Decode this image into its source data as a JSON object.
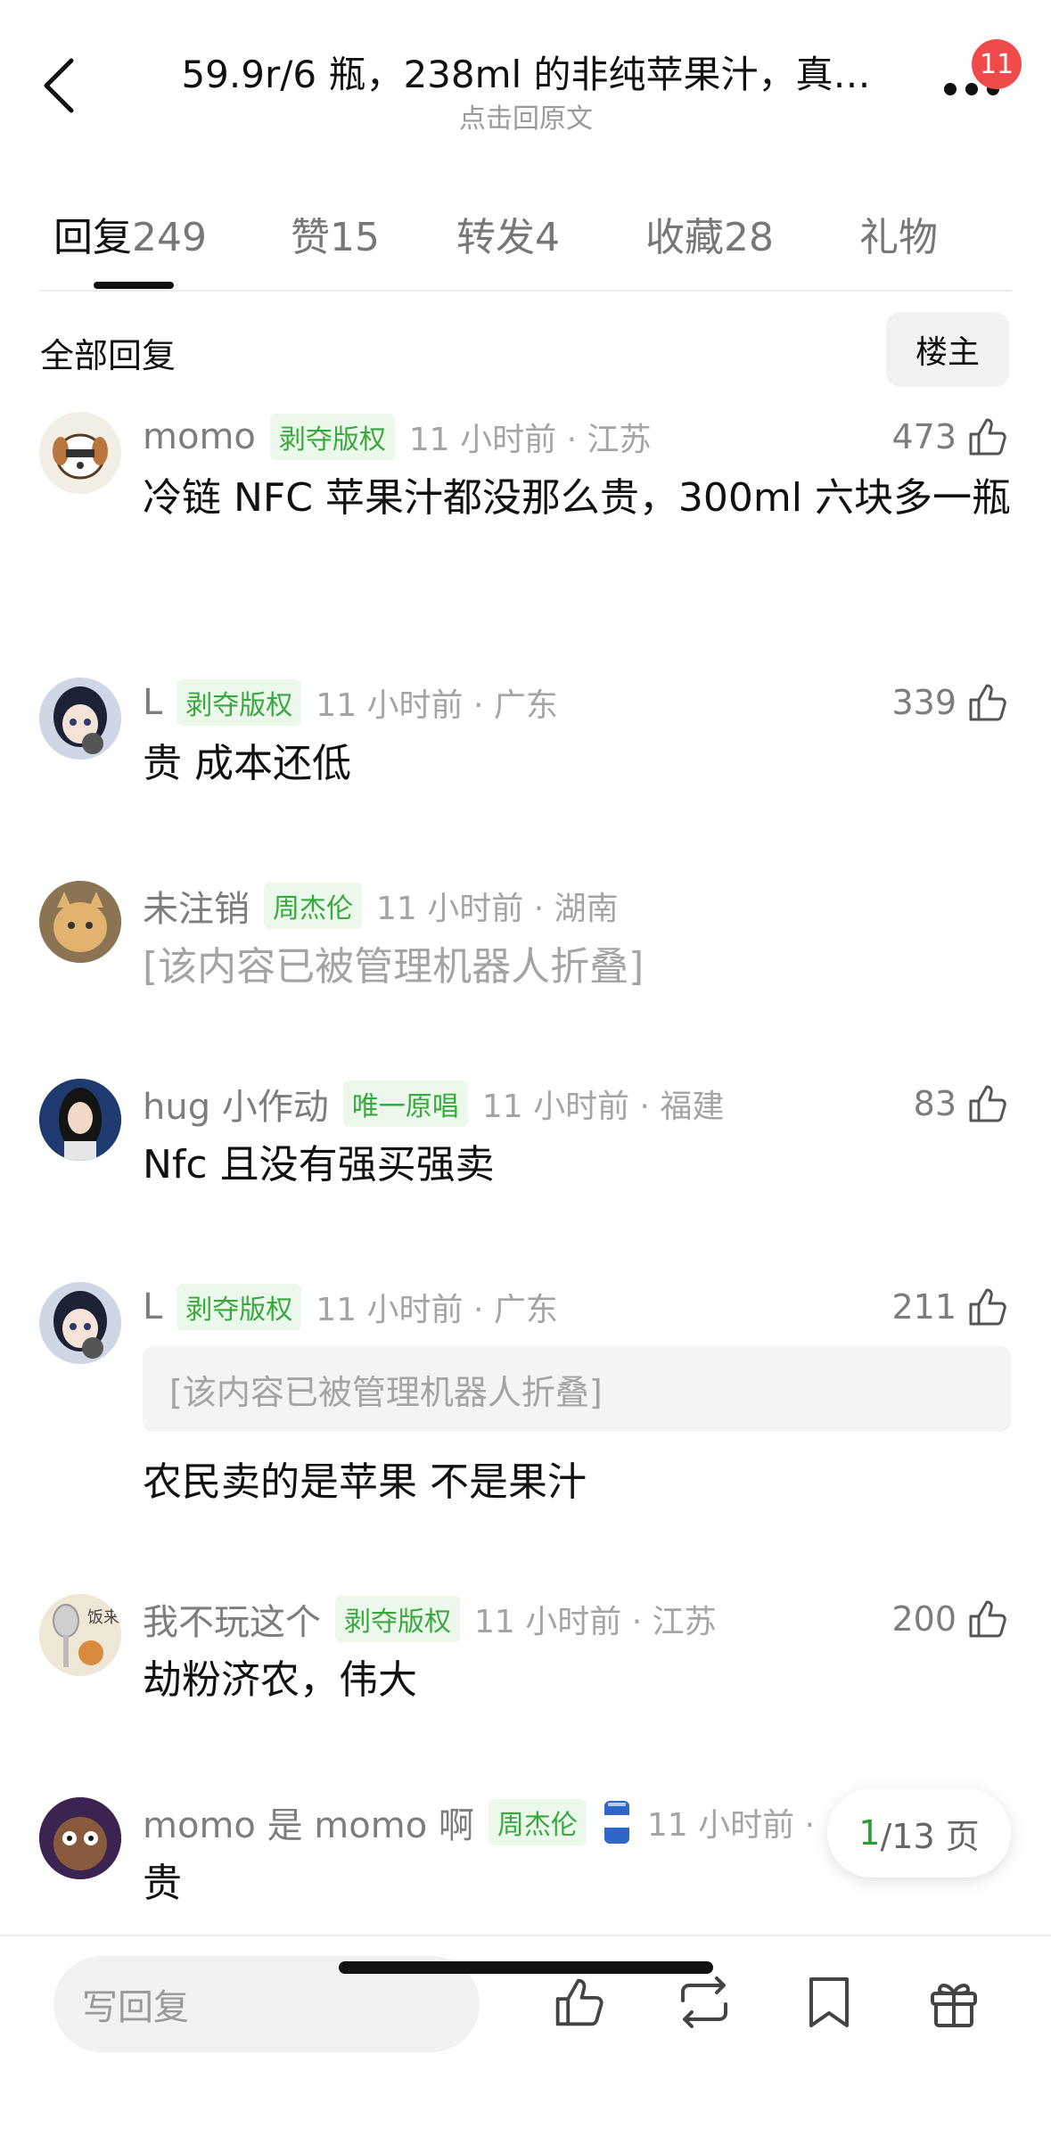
{
  "header": {
    "title": "59.9r/6 瓶，238ml 的非纯苹果汁，真…",
    "subtitle": "点击回原文",
    "badge_count": "11"
  },
  "tabs": [
    {
      "label": "回复",
      "count": "249",
      "active": true
    },
    {
      "label": "赞",
      "count": "15"
    },
    {
      "label": "转发",
      "count": "4"
    },
    {
      "label": "收藏",
      "count": "28"
    },
    {
      "label": "礼物",
      "count": ""
    }
  ],
  "section": {
    "title": "全部回复",
    "owner_button": "楼主"
  },
  "comments": [
    {
      "username": "momo",
      "tag": "剥夺版权",
      "time": "11 小时前 · 江苏",
      "likes": "473",
      "content": "冷链 NFC 苹果汁都没那么贵，300ml 六块多一瓶"
    },
    {
      "username": "L",
      "tag": "剥夺版权",
      "time": "11 小时前 · 广东",
      "likes": "339",
      "content": "贵 成本还低"
    },
    {
      "username": "未注销",
      "tag": "周杰伦",
      "time": "11 小时前 · 湖南",
      "likes": "",
      "content": "[该内容已被管理机器人折叠]"
    },
    {
      "username": "hug 小作动",
      "tag": "唯一原唱",
      "time": "11 小时前 · 福建",
      "likes": "83",
      "content": "Nfc 且没有强买强卖"
    },
    {
      "username": "L",
      "tag": "剥夺版权",
      "time": "11 小时前 · 广东",
      "likes": "211",
      "quote": "[该内容已被管理机器人折叠]",
      "content": "农民卖的是苹果 不是果汁"
    },
    {
      "username": "我不玩这个",
      "tag": "剥夺版权",
      "time": "11 小时前 · 江苏",
      "likes": "200",
      "content": "劫粉济农，伟大"
    },
    {
      "username": "momo 是 momo 啊",
      "tag": "周杰伦",
      "time": "11 小时前 · ",
      "likes": "",
      "content": "贵"
    }
  ],
  "pagination": {
    "current": "1",
    "total": "/13 页"
  },
  "bottom_bar": {
    "reply_placeholder": "写回复"
  },
  "colors": {
    "accent_green": "#39a93f",
    "badge_red": "#f04b4b"
  }
}
